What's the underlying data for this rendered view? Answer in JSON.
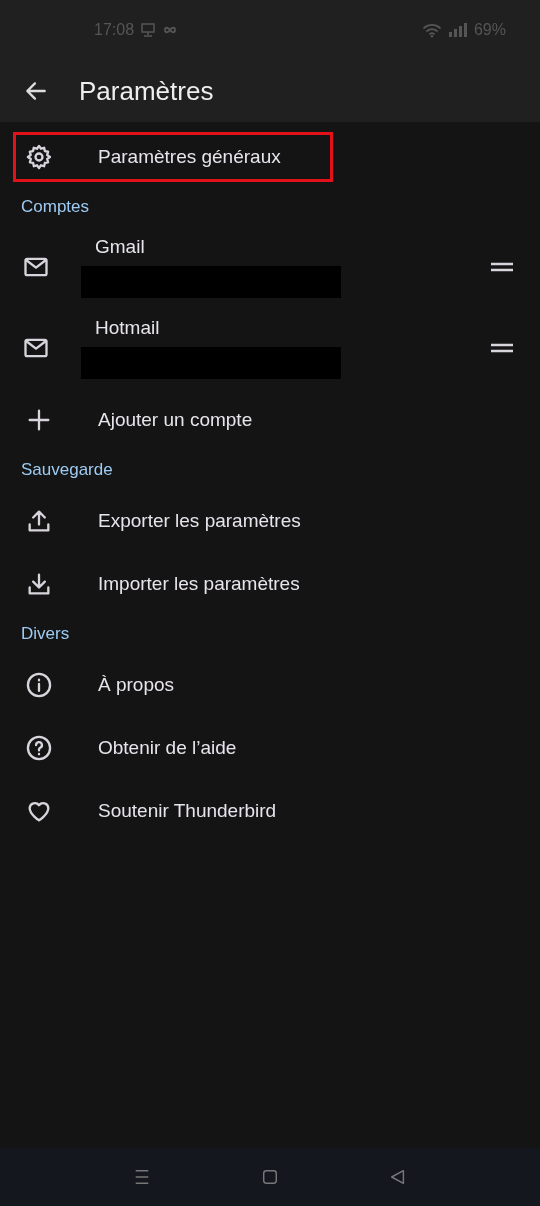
{
  "status_bar": {
    "time": "17:08",
    "battery": "69%"
  },
  "app_bar": {
    "title": "Paramètres"
  },
  "items": [
    {
      "kind": "item",
      "label": "Paramètres généraux",
      "highlighted": true
    },
    {
      "kind": "header",
      "label": "Comptes"
    },
    {
      "kind": "account",
      "label": "Gmail",
      "redacted": true
    },
    {
      "kind": "account",
      "label": "Hotmail",
      "redacted": true
    },
    {
      "kind": "item",
      "label": "Ajouter un compte",
      "highlighted": false
    },
    {
      "kind": "header",
      "label": "Sauvegarde"
    },
    {
      "kind": "item",
      "label": "Exporter les paramètres",
      "highlighted": false
    },
    {
      "kind": "item",
      "label": "Importer les paramètres",
      "highlighted": false
    },
    {
      "kind": "header",
      "label": "Divers"
    },
    {
      "kind": "item",
      "label": "À propos",
      "highlighted": false
    },
    {
      "kind": "item",
      "label": "Obtenir de l’aide",
      "highlighted": false
    },
    {
      "kind": "item",
      "label": "Soutenir Thunderbird",
      "highlighted": false
    }
  ]
}
